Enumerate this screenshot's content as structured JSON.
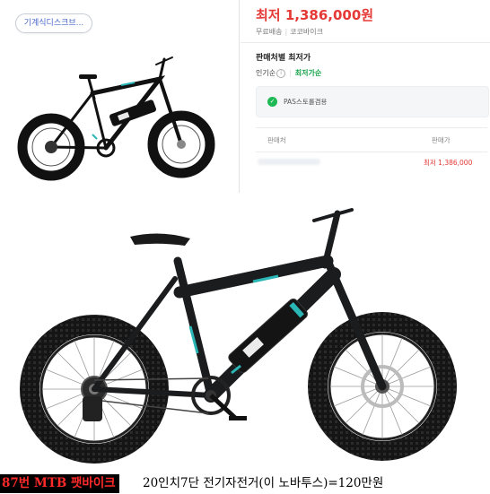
{
  "top_photo": {
    "chip_label": "기계식디스크브..."
  },
  "price": {
    "label": "최저",
    "value": "1,386,000원"
  },
  "meta": {
    "shipping": "무료배송",
    "brand": "코코바이크"
  },
  "sellers": {
    "title": "판매처별 최저가",
    "tab_popular": "인기순",
    "tab_popular_info": "i",
    "tab_lowest": "최저가순",
    "filter_label": "PAS스토롤겸용",
    "col_seller": "판매처",
    "col_price": "판매가",
    "rows": [
      {
        "price": "최저 1,386,000"
      }
    ]
  },
  "caption": {
    "tag": "87번 MTB 팻바이크",
    "text": "20인치7단 전기자전거(이 노바투스)=120만원"
  },
  "colors": {
    "accent_red": "#e53935",
    "accent_green": "#17a34a",
    "frame": "#1b1c1e",
    "teal": "#2bb6b6"
  },
  "icons": {
    "check": "check-circle-icon",
    "info": "info-icon"
  }
}
